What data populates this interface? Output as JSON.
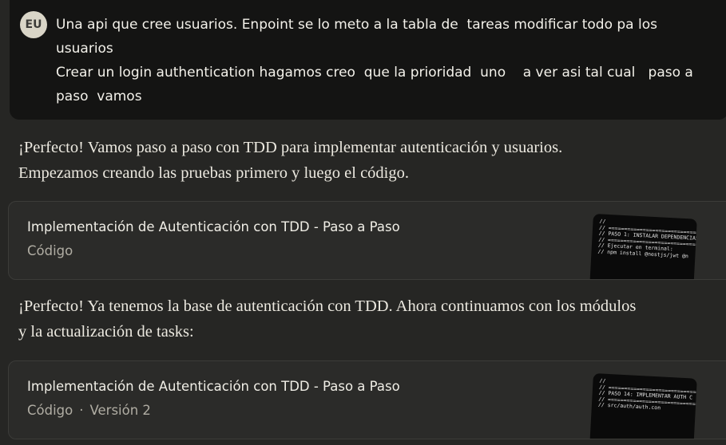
{
  "user_message": {
    "avatar": "EU",
    "lines": [
      "Una api que cree usuarios. Enpoint se lo meto a la tabla de  tareas modificar todo pa los",
      "usuarios",
      "Crear un login authentication hagamos creo  que la prioridad  uno    a ver asi tal cual   paso a",
      "paso  vamos"
    ]
  },
  "assistant_1": {
    "lines": [
      "¡Perfecto! Vamos paso a paso con TDD para implementar autenticación y usuarios.",
      "Empezamos creando las pruebas primero y luego el código."
    ]
  },
  "artifact_1": {
    "title": "Implementación de Autenticación con TDD - Paso a Paso",
    "type": "Código",
    "thumb_lines": [
      "//",
      "// ==================================",
      "// PASO 1: INSTALAR DEPENDENCIAS",
      "// ==================================",
      "",
      "// Ejecutar en terminal:",
      "// npm install @nestjs/jwt @n"
    ]
  },
  "assistant_2": {
    "lines": [
      "¡Perfecto! Ya tenemos la base de autenticación con TDD. Ahora continuamos con los módulos",
      "y la actualización de tasks:"
    ]
  },
  "artifact_2": {
    "title": "Implementación de Autenticación con TDD - Paso a Paso",
    "type": "Código",
    "separator": "·",
    "version": "Versión 2",
    "thumb_lines": [
      "//",
      "// ==================================",
      "// PASO 14: IMPLEMENTAR AUTH C",
      "// ==================================",
      "",
      "// src/auth/auth.con"
    ]
  }
}
